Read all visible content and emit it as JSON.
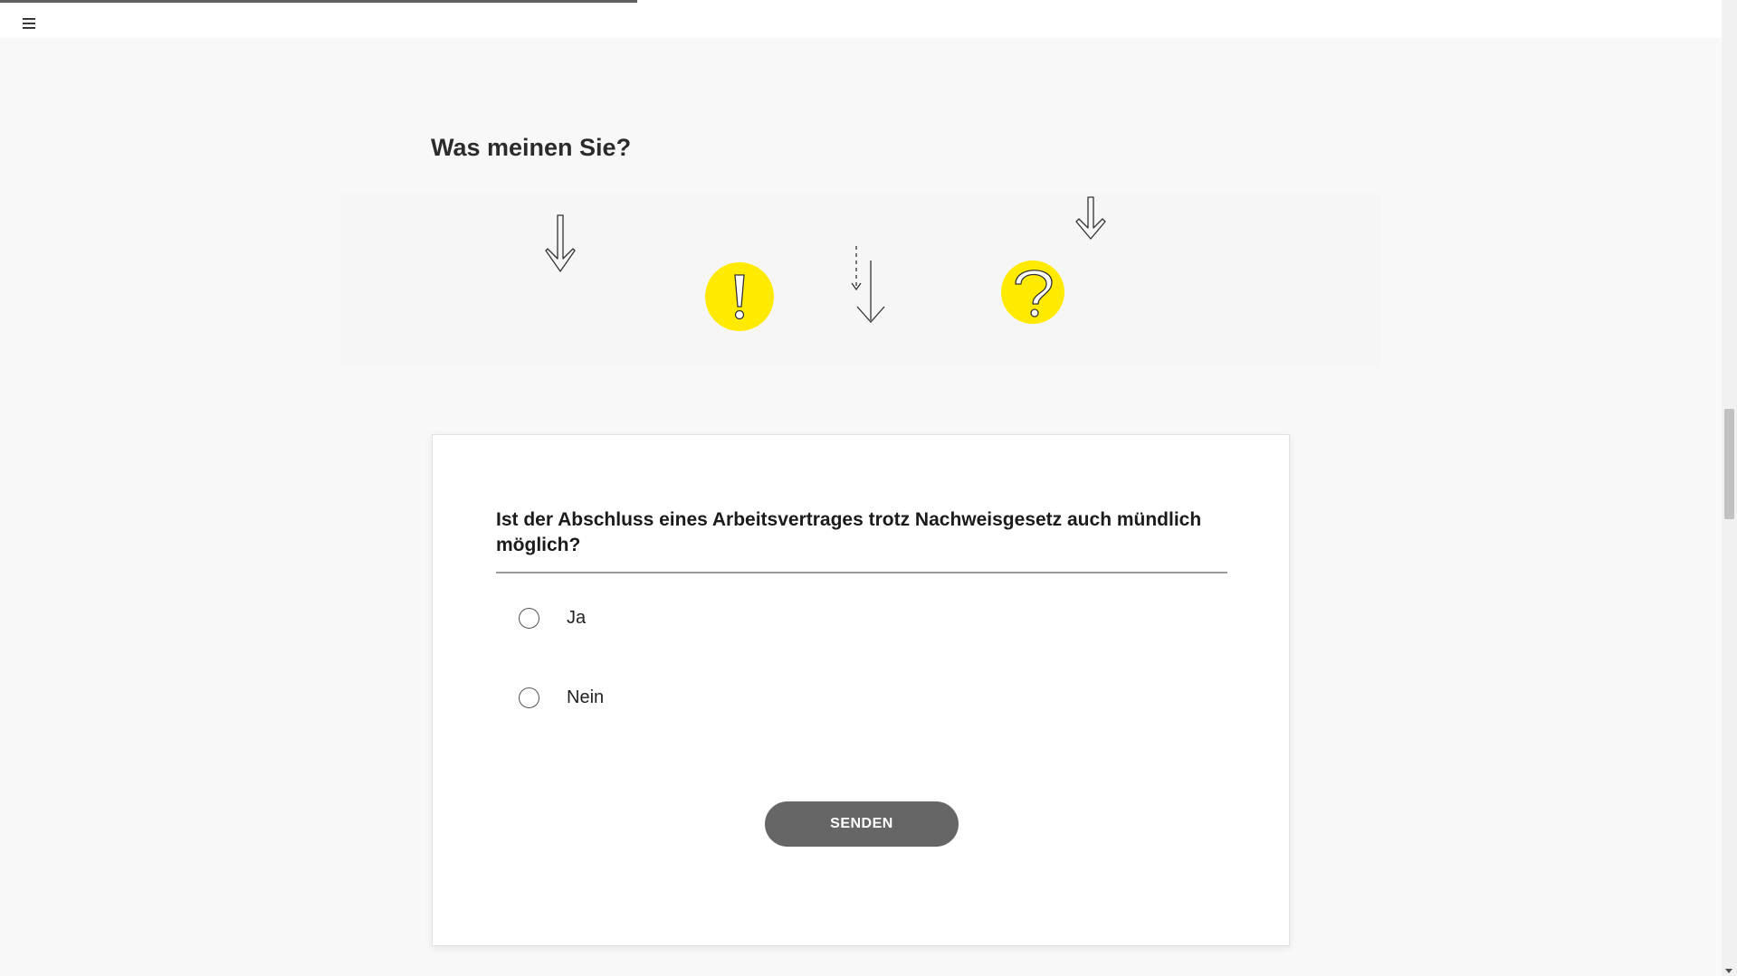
{
  "header": {
    "menu_icon": "hamburger-icon",
    "progress": 0.37
  },
  "section": {
    "title": "Was meinen Sie?"
  },
  "illustration": {
    "icons": [
      "arrow-down-icon",
      "exclamation-icon",
      "dashed-arrow-down-icon",
      "question-icon",
      "arrow-down-icon"
    ],
    "accent_color": "#ffea00"
  },
  "quiz": {
    "question": "Ist der Abschluss eines Arbeitsvertrages trotz Nachweisgesetz auch mündlich möglich?",
    "options": [
      {
        "label": "Ja",
        "selected": false
      },
      {
        "label": "Nein",
        "selected": false
      }
    ],
    "submit_label": "SENDEN",
    "button_color": "#666666"
  }
}
